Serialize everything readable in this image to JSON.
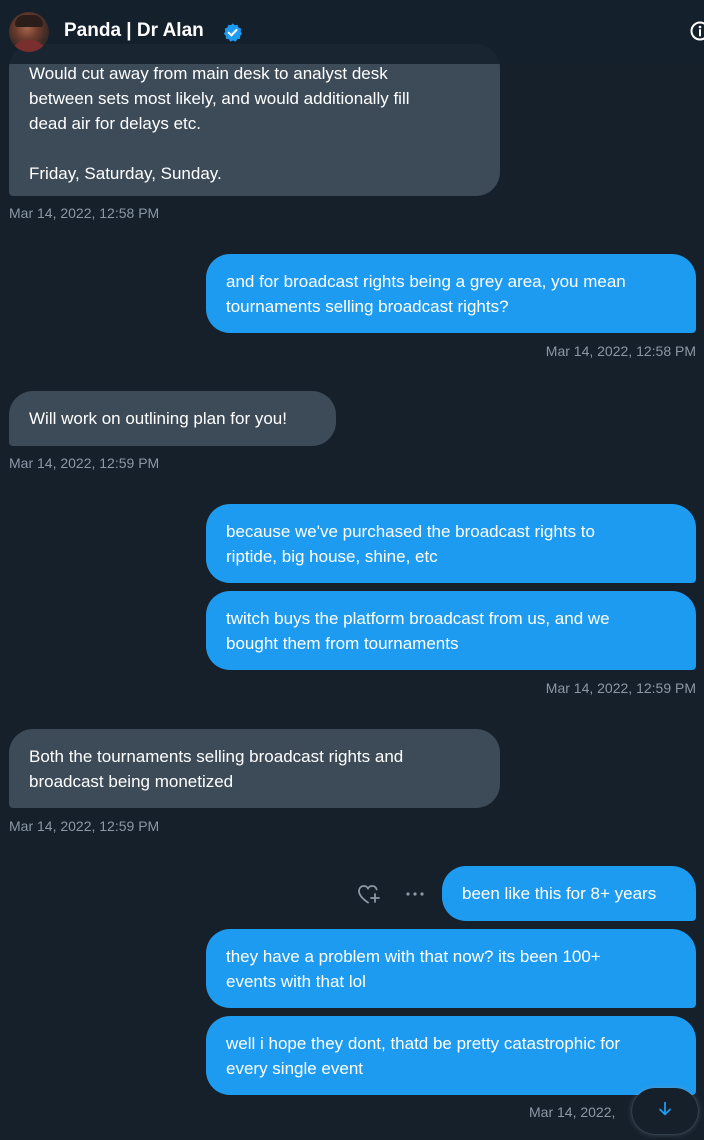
{
  "header": {
    "contact_name": "Panda | Dr Alan",
    "verified_icon": "verified-badge-icon",
    "info_icon": "info-icon"
  },
  "messages": [
    {
      "direction": "in",
      "text": "Would cut away from main desk to analyst desk\nbetween sets most likely, and would additionally fill\ndead air for delays etc.\n\nFriday, Saturday, Sunday.",
      "timestamp": "Mar 14, 2022, 12:58 PM"
    },
    {
      "direction": "out",
      "text": "and for broadcast rights being a grey area, you mean\ntournaments selling broadcast rights?",
      "timestamp": "Mar 14, 2022, 12:58 PM"
    },
    {
      "direction": "in",
      "text": "Will work on outlining plan for you!",
      "timestamp": "Mar 14, 2022, 12:59 PM"
    },
    {
      "direction": "out",
      "text": "because we've purchased the broadcast rights to\nriptide, big house, shine, etc"
    },
    {
      "direction": "out",
      "text": "twitch buys the platform broadcast from us, and we\nbought them from tournaments",
      "timestamp": "Mar 14, 2022, 12:59 PM"
    },
    {
      "direction": "in",
      "text": "Both the tournaments selling broadcast rights and\nbroadcast being monetized",
      "timestamp": "Mar 14, 2022, 12:59 PM"
    },
    {
      "direction": "out",
      "text": "been like this for 8+ years"
    },
    {
      "direction": "out",
      "text": "they have a problem with that now? its been 100+\nevents with that lol"
    },
    {
      "direction": "out",
      "text": "well i hope they dont, thatd be pretty catastrophic for\nevery single event",
      "timestamp": "Mar 14, 2022,"
    }
  ],
  "actions": {
    "like_icon": "heart-plus-icon",
    "more_icon": "more-dots-icon"
  },
  "scroll_button_icon": "arrow-down-icon",
  "colors": {
    "background": "#15202b",
    "incoming_bubble": "#3d4b59",
    "outgoing_bubble": "#1d9bf0",
    "timestamp": "#8b98a5",
    "accent": "#1d9bf0"
  }
}
